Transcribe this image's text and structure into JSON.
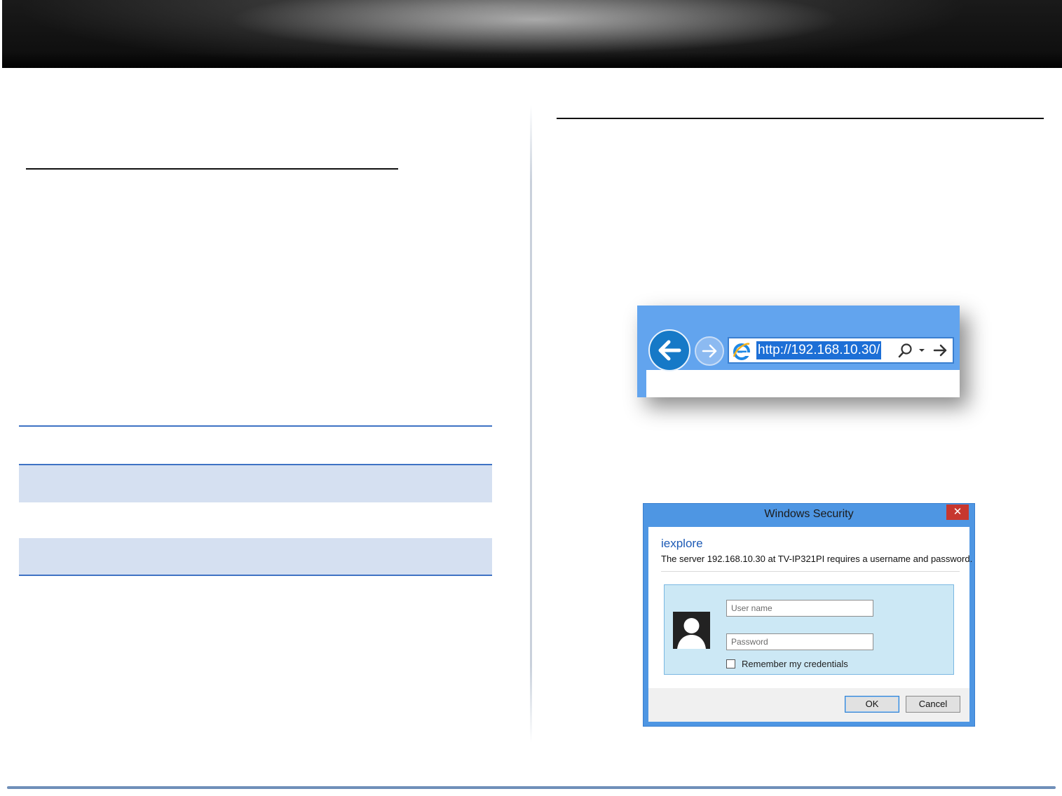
{
  "browser": {
    "url": "http://192.168.10.30/"
  },
  "dialog": {
    "title": "Windows Security",
    "close_glyph": "✕",
    "app_name": "iexplore",
    "message": "The server 192.168.10.30 at TV-IP321PI requires a username and password.",
    "username_placeholder": "User name",
    "password_placeholder": "Password",
    "remember_label": "Remember my credentials",
    "ok_label": "OK",
    "cancel_label": "Cancel"
  },
  "icons": {
    "back": "back-arrow-icon",
    "forward": "forward-arrow-icon",
    "browser": "internet-explorer-icon",
    "search": "search-icon",
    "dropdown": "chevron-down-icon",
    "go": "go-arrow-icon",
    "user": "user-avatar-icon"
  },
  "colors": {
    "accent_blue": "#3e72c4",
    "table_band": "#d5e0f1",
    "browser_chrome": "#62a4ee",
    "dialog_frame": "#4e96e3",
    "close_red": "#c7372f"
  }
}
